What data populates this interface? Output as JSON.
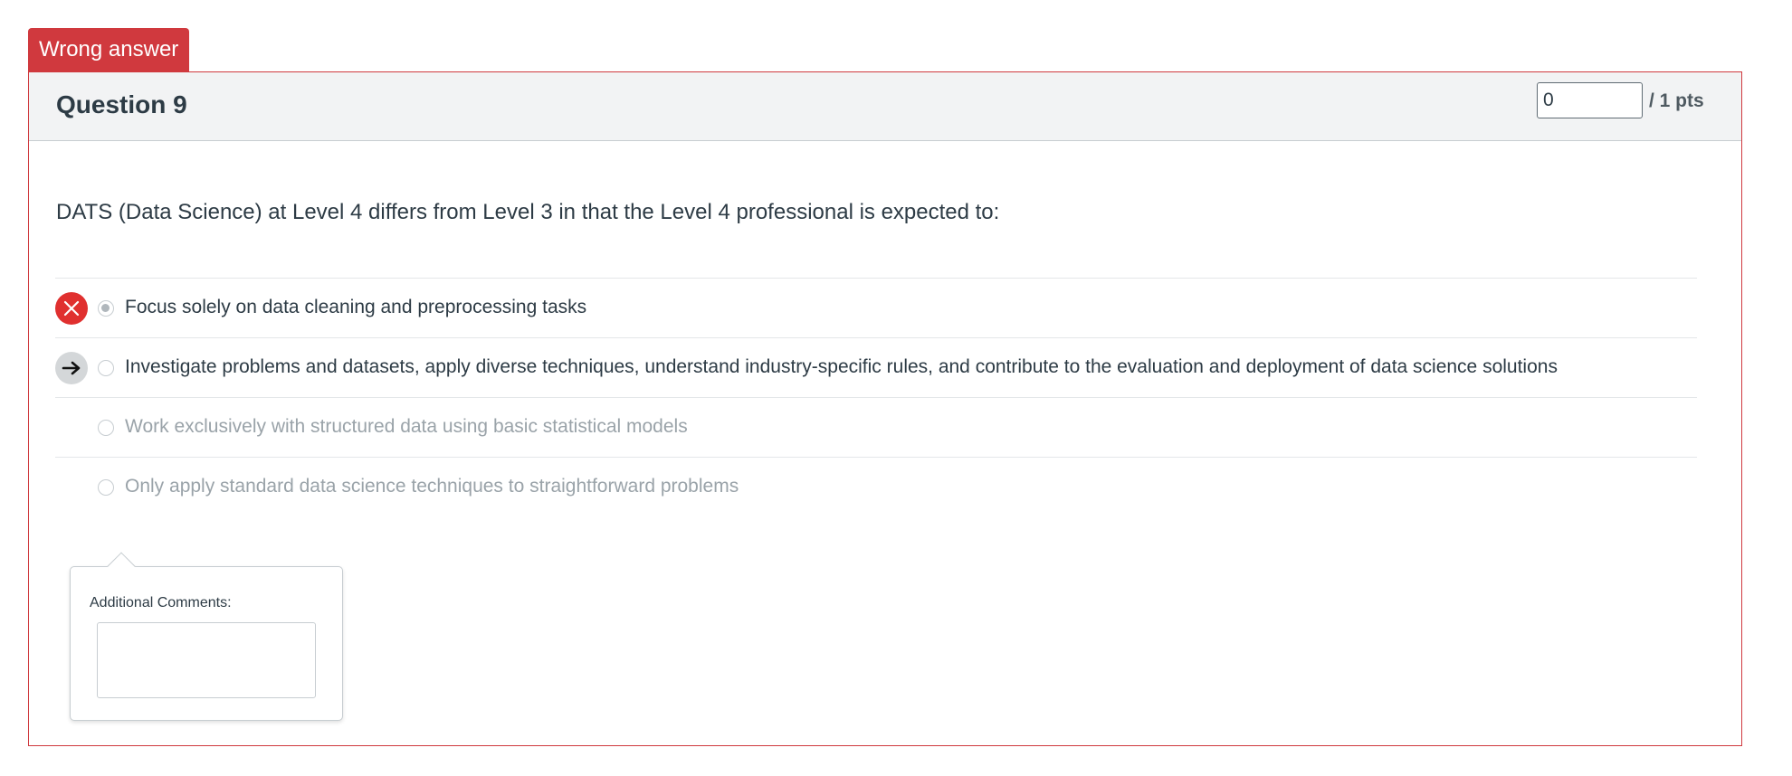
{
  "badge": {
    "label": "Wrong answer",
    "color": "#d0393e"
  },
  "question": {
    "title": "Question 9",
    "score_value": "0",
    "points_label": "/ 1 pts",
    "text": "DATS (Data Science) at Level 4 differs from Level 3 in that the Level 4 professional is expected to:"
  },
  "answers": [
    {
      "text": "Focus solely on data cleaning and preprocessing tasks",
      "selected": true,
      "marker": "x-icon",
      "state": "wrong"
    },
    {
      "text": "Investigate problems and datasets, apply diverse techniques, understand industry-specific rules, and contribute to the evaluation and deployment of data science solutions",
      "selected": false,
      "marker": "arrow-right-icon",
      "state": "correct"
    },
    {
      "text": "Work exclusively with structured data using basic statistical models",
      "selected": false,
      "marker": "",
      "state": "unselected"
    },
    {
      "text": "Only apply standard data science techniques to straightforward problems",
      "selected": false,
      "marker": "",
      "state": "unselected"
    }
  ],
  "comments": {
    "label": "Additional Comments:",
    "value": ""
  }
}
